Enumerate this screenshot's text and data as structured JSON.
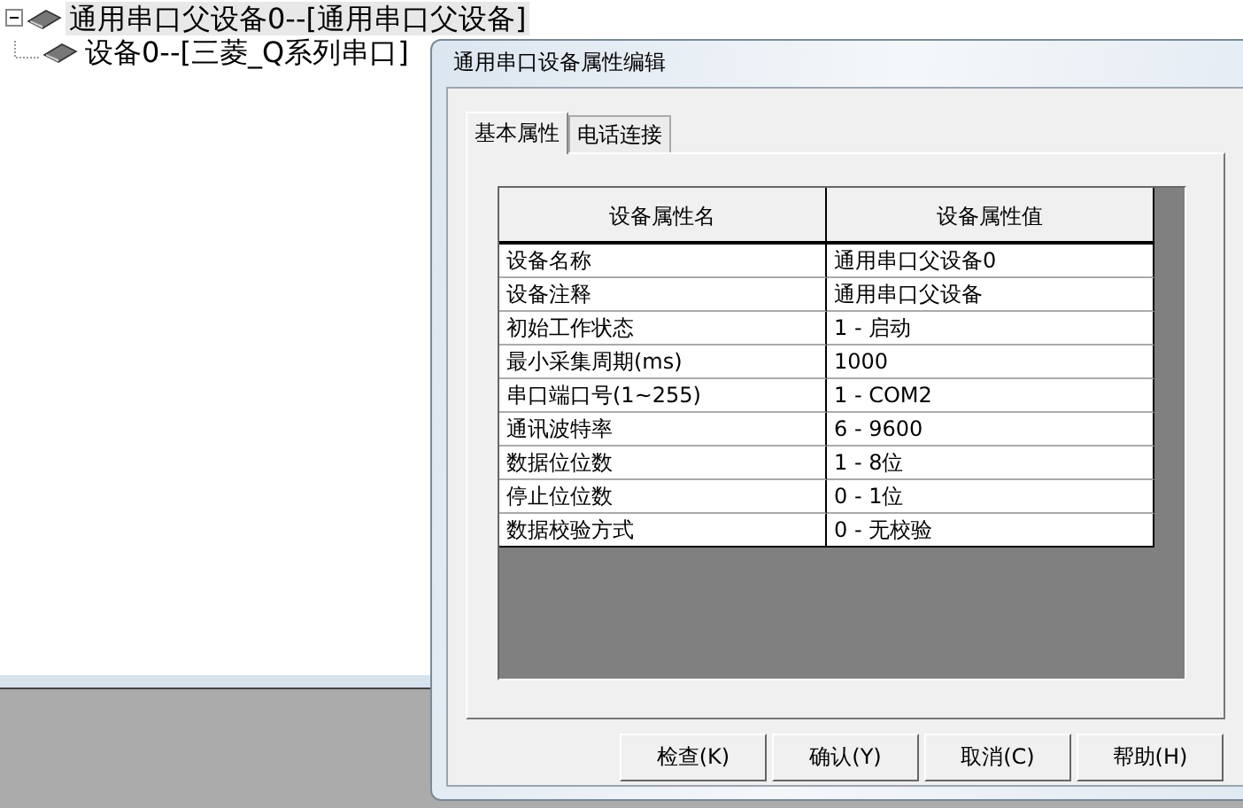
{
  "tree": [
    {
      "label": "通用串口父设备0--[通用串口父设备]",
      "selected": true,
      "expanded": true,
      "children": [
        {
          "label": "设备0--[三菱_Q系列串口]",
          "selected": false
        }
      ]
    }
  ],
  "dialog": {
    "title": "通用串口设备属性编辑",
    "tabs": [
      {
        "label": "基本属性",
        "selected": true
      },
      {
        "label": "电话连接",
        "selected": false
      }
    ],
    "table": {
      "columns": [
        "设备属性名",
        "设备属性值"
      ],
      "rows": [
        [
          "设备名称",
          "通用串口父设备0"
        ],
        [
          "设备注释",
          "通用串口父设备"
        ],
        [
          "初始工作状态",
          "1 - 启动"
        ],
        [
          "最小采集周期(ms)",
          "1000"
        ],
        [
          "串口端口号(1~255)",
          "1 - COM2"
        ],
        [
          "通讯波特率",
          "6 - 9600"
        ],
        [
          "数据位位数",
          "1 - 8位"
        ],
        [
          "停止位位数",
          "0 - 1位"
        ],
        [
          "数据校验方式",
          "0 - 无校验"
        ]
      ]
    },
    "buttons": [
      "检查(K)",
      "确认(Y)",
      "取消(C)",
      "帮助(H)"
    ]
  }
}
